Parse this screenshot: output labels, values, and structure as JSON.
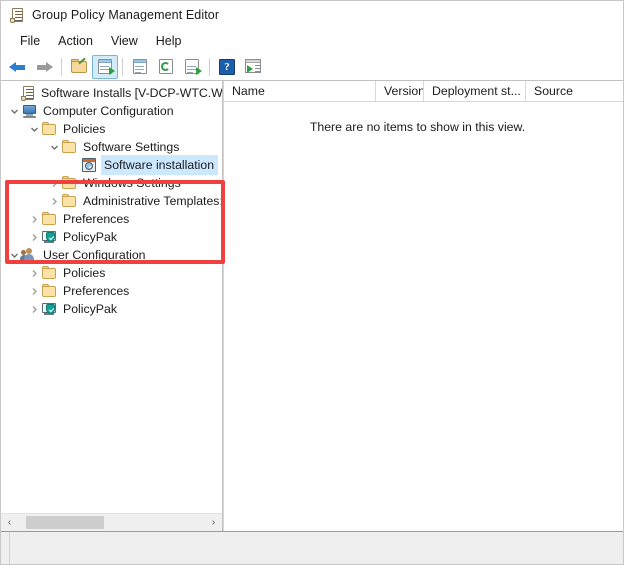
{
  "window": {
    "title": "Group Policy Management Editor",
    "title_icon": "gpme-scroll-icon"
  },
  "menubar": {
    "items": [
      {
        "label": "File"
      },
      {
        "label": "Action"
      },
      {
        "label": "View"
      },
      {
        "label": "Help"
      }
    ]
  },
  "toolbar": {
    "buttons": [
      {
        "name": "back-button",
        "icon": "back-arrow-icon",
        "active": false
      },
      {
        "name": "forward-button",
        "icon": "forward-arrow-icon",
        "active": false
      },
      {
        "name": "up-one-level-button",
        "icon": "folder-up-icon",
        "active": false
      },
      {
        "name": "show-hide-console-tree-button",
        "icon": "console-tree-icon",
        "active": true
      },
      {
        "name": "properties-button",
        "icon": "properties-icon",
        "active": false
      },
      {
        "name": "refresh-button",
        "icon": "refresh-icon",
        "active": false
      },
      {
        "name": "export-list-button",
        "icon": "export-list-icon",
        "active": false
      },
      {
        "name": "help-button",
        "icon": "help-question-icon",
        "active": false
      },
      {
        "name": "show-hide-action-pane-button",
        "icon": "action-pane-icon",
        "active": false
      }
    ]
  },
  "tree": {
    "nodes": [
      {
        "id": "root",
        "label": "Software Installs [V-DCP-WTC.WHISK",
        "icon": "gpo-scroll-icon",
        "indent": 0,
        "twisty": "none",
        "selected": false
      },
      {
        "id": "computer-configuration",
        "label": "Computer Configuration",
        "icon": "computer-icon",
        "indent": 1,
        "twisty": "expanded",
        "selected": false
      },
      {
        "id": "computer-policies",
        "label": "Policies",
        "icon": "folder-icon",
        "indent": 2,
        "twisty": "expanded",
        "selected": false
      },
      {
        "id": "software-settings",
        "label": "Software Settings",
        "icon": "folder-icon",
        "indent": 3,
        "twisty": "expanded",
        "selected": false
      },
      {
        "id": "software-installation",
        "label": "Software installation",
        "icon": "software-installation-icon",
        "indent": 4,
        "twisty": "none",
        "selected": true
      },
      {
        "id": "windows-settings",
        "label": "Windows Settings",
        "icon": "folder-icon",
        "indent": 3,
        "twisty": "collapsed",
        "selected": false
      },
      {
        "id": "administrative-templates",
        "label": "Administrative Templates:",
        "icon": "folder-icon",
        "indent": 3,
        "twisty": "collapsed",
        "selected": false
      },
      {
        "id": "computer-preferences",
        "label": "Preferences",
        "icon": "folder-icon",
        "indent": 2,
        "twisty": "collapsed",
        "selected": false
      },
      {
        "id": "computer-policypak",
        "label": "PolicyPak",
        "icon": "policypak-icon",
        "indent": 2,
        "twisty": "collapsed",
        "selected": false
      },
      {
        "id": "user-configuration",
        "label": "User Configuration",
        "icon": "users-icon",
        "indent": 1,
        "twisty": "expanded",
        "selected": false
      },
      {
        "id": "user-policies",
        "label": "Policies",
        "icon": "folder-icon",
        "indent": 2,
        "twisty": "collapsed",
        "selected": false
      },
      {
        "id": "user-preferences",
        "label": "Preferences",
        "icon": "folder-icon",
        "indent": 2,
        "twisty": "collapsed",
        "selected": false
      },
      {
        "id": "user-policypak",
        "label": "PolicyPak",
        "icon": "policypak-icon",
        "indent": 2,
        "twisty": "collapsed",
        "selected": false
      }
    ],
    "hscroll": {
      "left_arrow": "‹",
      "right_arrow": "›"
    }
  },
  "list": {
    "columns": [
      {
        "label": "Name"
      },
      {
        "label": "Version"
      },
      {
        "label": "Deployment st..."
      },
      {
        "label": "Source"
      }
    ],
    "empty_message": "There are no items to show in this view."
  },
  "annotation": {
    "highlight_color": "#f04040"
  }
}
